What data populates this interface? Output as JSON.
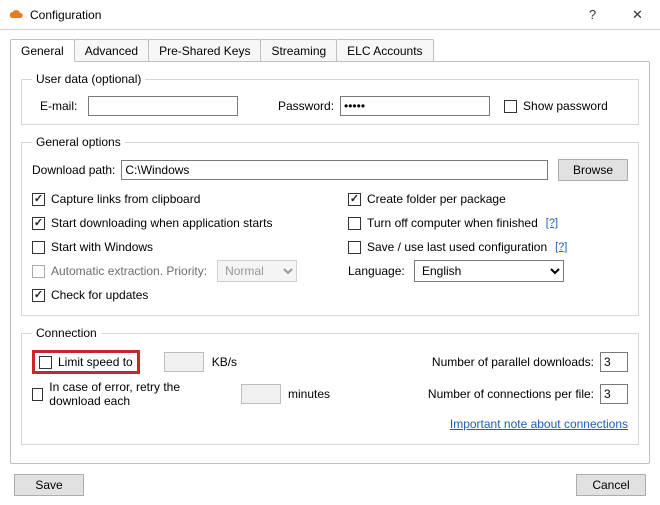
{
  "window": {
    "title": "Configuration",
    "help": "?",
    "close": "✕"
  },
  "tabs": [
    "General",
    "Advanced",
    "Pre-Shared Keys",
    "Streaming",
    "ELC Accounts"
  ],
  "userdata": {
    "legend": "User data (optional)",
    "email_label": "E-mail:",
    "email_value": "",
    "password_label": "Password:",
    "password_value": "•••••",
    "show_password_label": "Show password"
  },
  "general": {
    "legend": "General options",
    "download_path_label": "Download path:",
    "download_path_value": "C:\\Windows",
    "browse": "Browse",
    "left": {
      "capture": "Capture links from clipboard",
      "autostart": "Start downloading when application starts",
      "startwin": "Start with Windows",
      "autoextract": "Automatic extraction. Priority:",
      "priority": "Normal",
      "updates": "Check for updates"
    },
    "right": {
      "folder_pkg": "Create folder per package",
      "poweroff": "Turn off computer when finished",
      "reuse_cfg": "Save / use last used configuration",
      "language_label": "Language:",
      "language_value": "English",
      "help": "[?]"
    }
  },
  "connection": {
    "legend": "Connection",
    "limit_label": "Limit speed to",
    "limit_value": "",
    "kbs": "KB/s",
    "retry_label": "In case of error, retry the download each",
    "retry_value": "",
    "minutes": "minutes",
    "parallel_label": "Number of parallel downloads:",
    "parallel_value": "3",
    "perfile_label": "Number of connections per file:",
    "perfile_value": "3",
    "note": "Important note about connections"
  },
  "footer": {
    "save": "Save",
    "cancel": "Cancel"
  }
}
